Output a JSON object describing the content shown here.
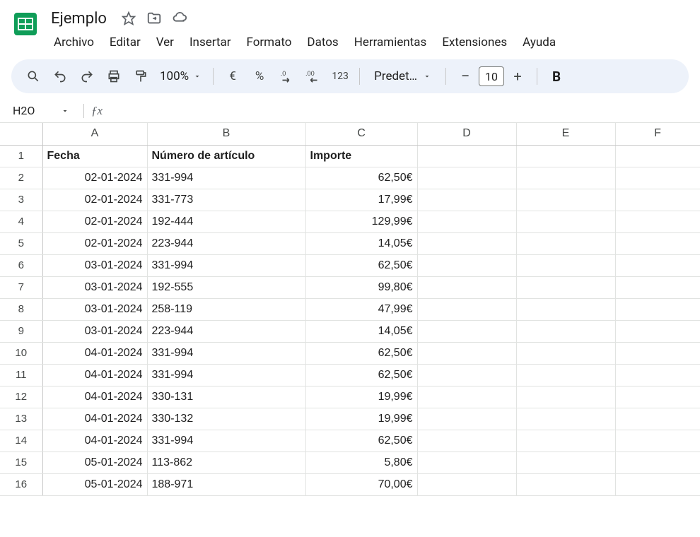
{
  "header": {
    "title": "Ejemplo",
    "menus": [
      "Archivo",
      "Editar",
      "Ver",
      "Insertar",
      "Formato",
      "Datos",
      "Herramientas",
      "Extensiones",
      "Ayuda"
    ]
  },
  "toolbar": {
    "zoom": "100%",
    "currency": "€",
    "percent": "%",
    "number_indicator": "123",
    "font": "Predet…",
    "font_size": "10",
    "bold": "B"
  },
  "namebox": {
    "ref": "H2O"
  },
  "grid": {
    "columns": [
      "A",
      "B",
      "C",
      "D",
      "E",
      "F"
    ],
    "headers": [
      "Fecha",
      "Número de artículo",
      "Importe"
    ],
    "rows": [
      {
        "n": "1"
      },
      {
        "n": "2",
        "A": "02-01-2024",
        "B": "331-994",
        "C": "62,50€"
      },
      {
        "n": "3",
        "A": "02-01-2024",
        "B": "331-773",
        "C": "17,99€"
      },
      {
        "n": "4",
        "A": "02-01-2024",
        "B": "192-444",
        "C": "129,99€"
      },
      {
        "n": "5",
        "A": "02-01-2024",
        "B": "223-944",
        "C": "14,05€"
      },
      {
        "n": "6",
        "A": "03-01-2024",
        "B": "331-994",
        "C": "62,50€"
      },
      {
        "n": "7",
        "A": "03-01-2024",
        "B": "192-555",
        "C": "99,80€"
      },
      {
        "n": "8",
        "A": "03-01-2024",
        "B": "258-119",
        "C": "47,99€"
      },
      {
        "n": "9",
        "A": "03-01-2024",
        "B": "223-944",
        "C": "14,05€"
      },
      {
        "n": "10",
        "A": "04-01-2024",
        "B": "331-994",
        "C": "62,50€"
      },
      {
        "n": "11",
        "A": "04-01-2024",
        "B": "331-994",
        "C": "62,50€"
      },
      {
        "n": "12",
        "A": "04-01-2024",
        "B": "330-131",
        "C": "19,99€"
      },
      {
        "n": "13",
        "A": "04-01-2024",
        "B": "330-132",
        "C": "19,99€"
      },
      {
        "n": "14",
        "A": "04-01-2024",
        "B": "331-994",
        "C": "62,50€"
      },
      {
        "n": "15",
        "A": "05-01-2024",
        "B": "113-862",
        "C": "5,80€"
      },
      {
        "n": "16",
        "A": "05-01-2024",
        "B": "188-971",
        "C": "70,00€"
      }
    ]
  }
}
